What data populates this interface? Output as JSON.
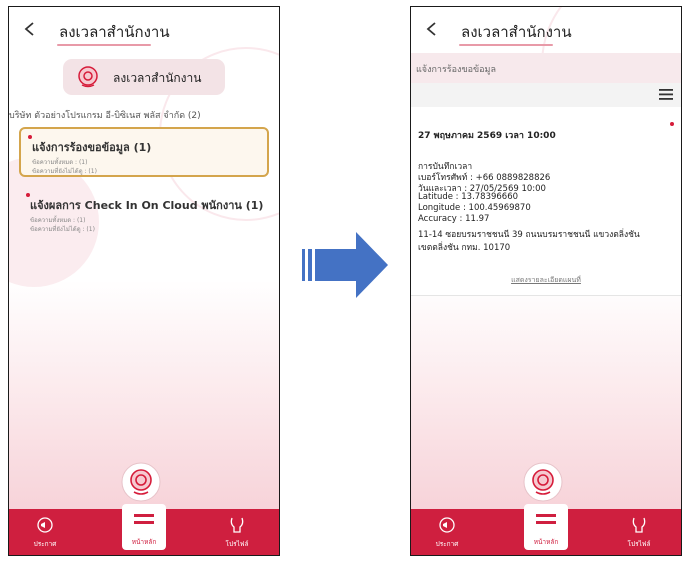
{
  "colors": {
    "brand_red": "#cf1f3f",
    "pill_bg": "#f3e3e6",
    "card_border": "#d4a54c",
    "arrow_blue": "#4472c4"
  },
  "left_screen": {
    "header": {
      "title": "ลงเวลาสำนักงาน",
      "back_icon": "chevron-left-icon"
    },
    "pill": {
      "label": "ลงเวลาสำนักงาน",
      "icon": "location-pin-icon"
    },
    "company": "บริษัท ตัวอย่างโปรแกรม อี-บิซิเนส พลัส จำกัด (2)",
    "cards": [
      {
        "title": "แจ้งการร้องขอข้อมูล (1)",
        "sub1": "ข้อความทั้งหมด : (1)",
        "sub2": "ข้อความที่ยังไม่ได้ดู : (1)"
      },
      {
        "title": "แจ้งผลการ Check In On Cloud พนักงาน (1)",
        "sub1": "ข้อความทั้งหมด : (1)",
        "sub2": "ข้อความที่ยังไม่ได้ดู : (1)"
      }
    ]
  },
  "right_screen": {
    "header": {
      "title": "ลงเวลาสำนักงาน",
      "back_icon": "chevron-left-icon"
    },
    "subheader": "แจ้งการร้องขอข้อมูล",
    "message": {
      "date": "27 พฤษภาคม 2569 เวลา 10:00",
      "lines": [
        "การบันทึกเวลา",
        "เบอร์โทรศัพท์ : +66 0889828826",
        "วันและเวลา : 27/05/2569 10:00",
        "Latitude : 13.78396660",
        "Longitude : 100.45969870",
        "Accuracy : 11.97",
        "11-14 ซอยบรมราชชนนี 39 ถนนบรมราชชนนี แขวงตลิ่งชัน",
        "เขตตลิ่งชัน กทม. 10170"
      ],
      "map_link": "แสดงรายละเอียดแผนที่"
    }
  },
  "tabbar": {
    "news": {
      "label": "ประกาศ",
      "icon": "megaphone-icon"
    },
    "home": {
      "label": "หน้าหลัก",
      "icon": "menu-lines-icon"
    },
    "profile": {
      "label": "โปรไฟล์",
      "icon": "profile-icon"
    }
  }
}
